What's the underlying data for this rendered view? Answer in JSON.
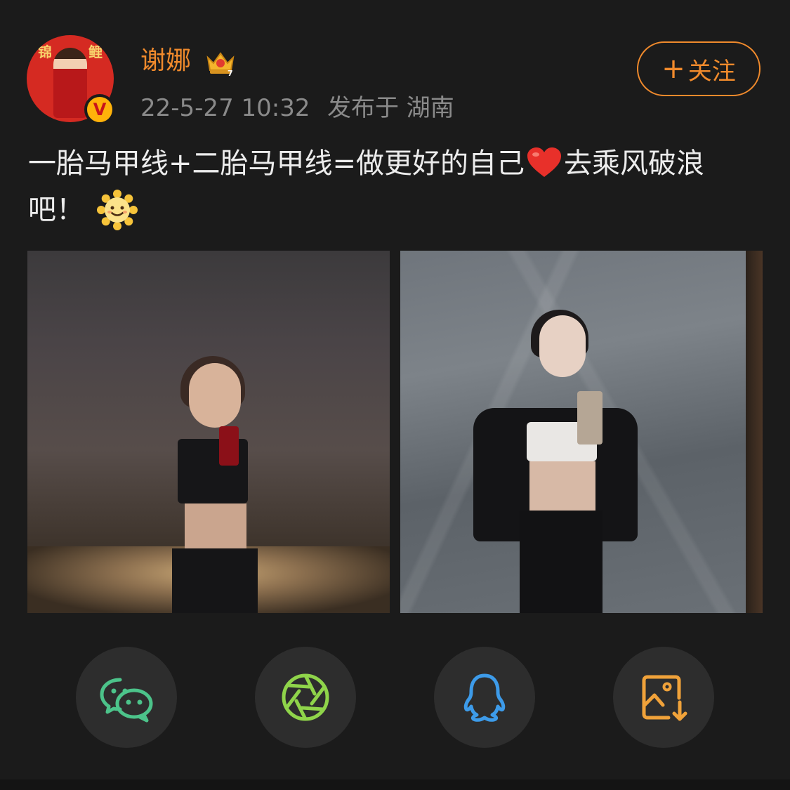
{
  "post": {
    "author": {
      "name": "谢娜",
      "avatar_text_left": "锦",
      "avatar_text_right": "鲤",
      "verified_badge": "V",
      "crown_level": "7"
    },
    "time": "22-5-27 10:32",
    "location": "发布于 湖南",
    "follow_plus": "+",
    "follow_label": "关注",
    "text_part1": "一胎马甲线+二胎马甲线=做更好的自己",
    "text_part2": "去乘风破浪吧！",
    "emojis": [
      "heart-icon",
      "smiling-sun-icon"
    ]
  },
  "share": [
    {
      "name": "wechat",
      "icon": "wechat-icon",
      "color": "#4cc38a"
    },
    {
      "name": "moments",
      "icon": "moments-shutter-icon",
      "color": "#8fd44a"
    },
    {
      "name": "qq",
      "icon": "qq-penguin-icon",
      "color": "#3d9be9"
    },
    {
      "name": "save-image",
      "icon": "save-image-icon",
      "color": "#f0a23a"
    }
  ],
  "colors": {
    "background": "#1b1b1b",
    "accent": "#f08a2c",
    "text": "#ececec",
    "meta": "#8a8a8a"
  }
}
